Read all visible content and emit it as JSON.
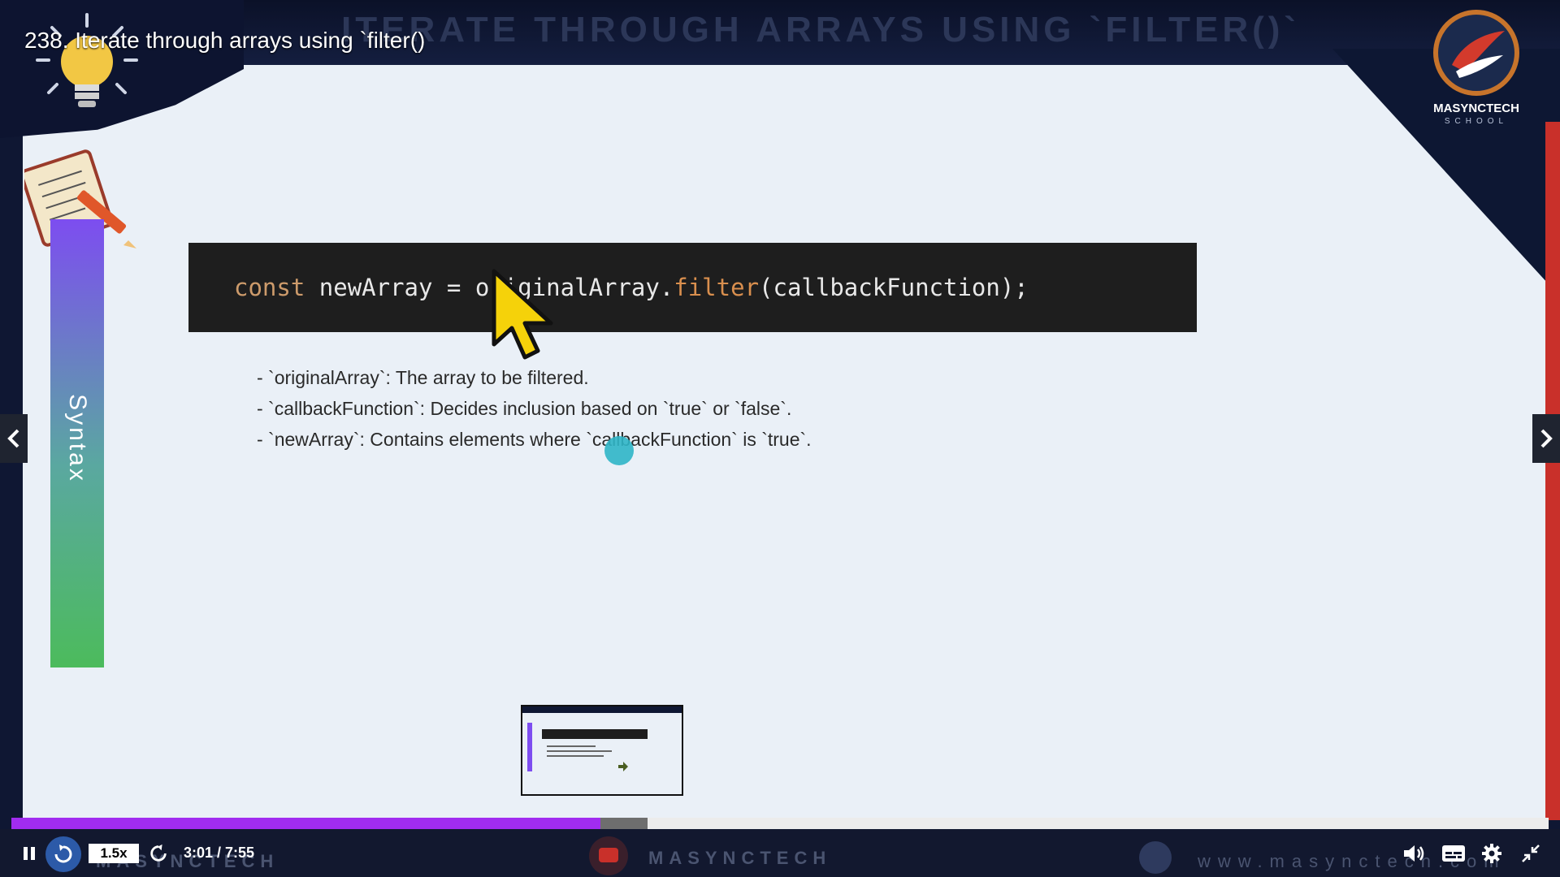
{
  "video": {
    "title": "238. Iterate through arrays using `filter()"
  },
  "slide": {
    "heading": "ITERATE THROUGH ARRAYS USING `FILTER()`",
    "side_label": "Syntax",
    "logo_name": "MASYNCTECH",
    "logo_sub": "SCHOOL",
    "code": {
      "keyword": "const",
      "var_part": " newArray = originalArray.",
      "method": "filter",
      "args": "(callbackFunction);"
    },
    "bullets": [
      "- `originalArray`: The array to be filtered.",
      "- `callbackFunction`: Decides inclusion based on `true` or `false`.",
      "- `newArray`: Contains elements where `callbackFunction` is `true`."
    ]
  },
  "player": {
    "speed": "1.5x",
    "time": "3:01 / 7:55",
    "progress_played": 0.383,
    "progress_buffered": 0.414,
    "watermark_left": "MASYNCTECH",
    "watermark_center": "MASYNCTECH",
    "watermark_right": "www.masynctech.com"
  },
  "icons": {
    "play_pause": "pause-icon",
    "rewind": "rewind-icon",
    "forward": "forward-icon",
    "volume": "volume-icon",
    "captions": "captions-icon",
    "settings": "gear-icon",
    "fullscreen": "exit-fullscreen-icon",
    "prev": "chevron-left-icon",
    "next": "chevron-right-icon"
  },
  "colors": {
    "progress_played": "#a12cf0",
    "code_bg": "#1e1e1e",
    "code_keyword": "#cd9b6b",
    "code_method": "#d98f4e",
    "accent_red": "#c9302a"
  }
}
